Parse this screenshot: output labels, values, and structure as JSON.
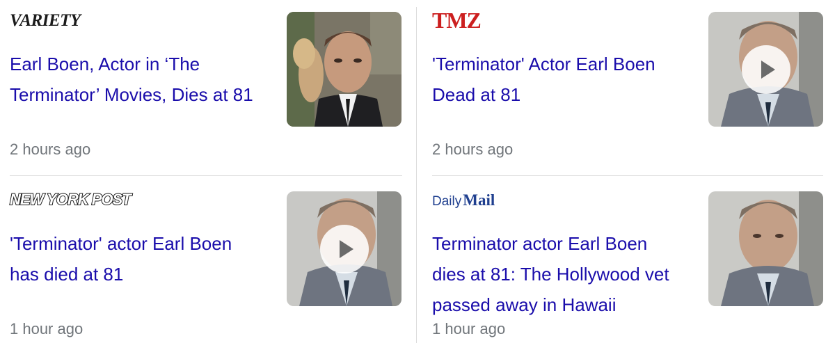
{
  "articles": [
    {
      "source": "Variety",
      "logo_text": "VARIETY",
      "headline": "Earl Boen, Actor in ‘The Terminator’ Movies, Dies at 81",
      "time": "2 hours ago",
      "has_video": false
    },
    {
      "source": "TMZ",
      "logo_text": "TMZ",
      "headline": "'Terminator' Actor Earl Boen Dead at 81",
      "time": "2 hours ago",
      "has_video": true
    },
    {
      "source": "New York Post",
      "logo_text": "NEW YORK POST",
      "headline": "'Terminator' actor Earl Boen has died at 81",
      "time": "1 hour ago",
      "has_video": true
    },
    {
      "source": "Daily Mail",
      "logo_daily": "Daily",
      "logo_mail": "Mail",
      "headline": "Terminator actor Earl Boen dies at 81: The Hollywood vet passed away in Hawaii",
      "time": "1 hour ago",
      "has_video": false
    }
  ],
  "colors": {
    "link": "#1a0dab",
    "meta": "#70757a",
    "divider": "#dcdcdc",
    "tmz_red": "#cc1f1f",
    "dailymail_blue": "#1f3f8f"
  },
  "icons": {
    "play": "play-icon"
  }
}
